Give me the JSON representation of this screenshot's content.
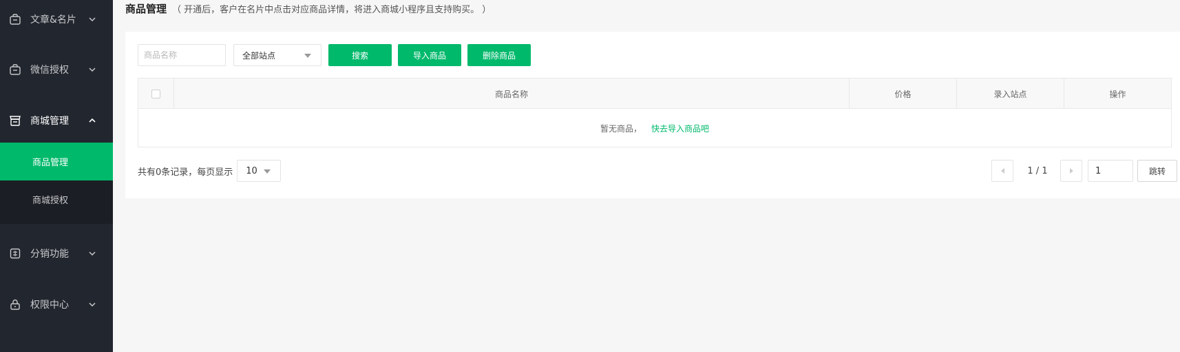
{
  "sidebar": {
    "groups": [
      {
        "label": "文章&名片",
        "icon": "briefcase-icon"
      },
      {
        "label": "微信授权",
        "icon": "briefcase-icon"
      },
      {
        "label": "商城管理",
        "icon": "store-icon"
      },
      {
        "label": "分销功能",
        "icon": "distribution-icon"
      },
      {
        "label": "权限中心",
        "icon": "lock-icon"
      }
    ],
    "submenu": [
      {
        "label": "商品管理",
        "active": true
      },
      {
        "label": "商城授权",
        "active": false
      }
    ]
  },
  "header": {
    "title": "商品管理",
    "desc": "（ 开通后，客户在名片中点击对应商品详情，将进入商城小程序且支持购买。 ）"
  },
  "toolbar": {
    "search_placeholder": "商品名称",
    "site_select": "全部站点",
    "search_label": "搜索",
    "import_label": "导入商品",
    "delete_label": "删除商品"
  },
  "table": {
    "columns": [
      "商品名称",
      "价格",
      "录入站点",
      "操作"
    ],
    "empty_text": "暂无商品，",
    "empty_link": "快去导入商品吧"
  },
  "pager": {
    "total_text": "共有0条记录，每页显示",
    "page_size": "10",
    "page_info": "1 / 1",
    "page_input": "1",
    "go_label": "跳转"
  },
  "colors": {
    "accent": "#00b96b",
    "sidebar_bg": "#22262e",
    "submenu_bg": "#1b1e25"
  }
}
